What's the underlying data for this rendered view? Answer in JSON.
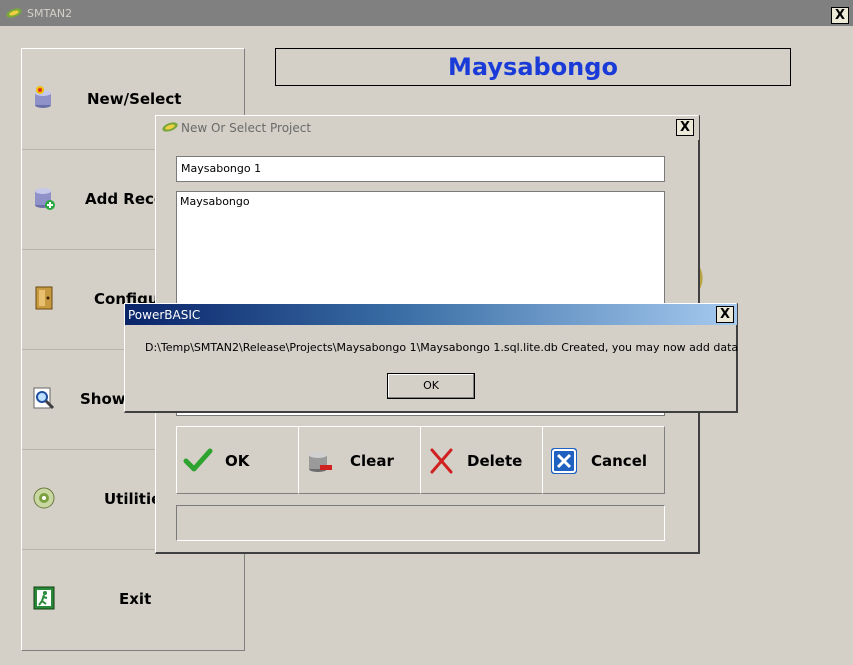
{
  "window": {
    "title": "SMTAN2",
    "close_label": "X"
  },
  "nav": {
    "items": [
      {
        "label": "New/Select",
        "icon": "new-database-icon"
      },
      {
        "label": "Add Records",
        "icon": "add-database-icon"
      },
      {
        "label": "Configure",
        "icon": "door-icon"
      },
      {
        "label": "Show",
        "icon": "magnifier-icon"
      },
      {
        "label": "Utilities",
        "icon": "cd-icon"
      },
      {
        "label": "Exit",
        "icon": "exit-icon"
      }
    ]
  },
  "project_banner": "Maysabongo",
  "background_fragment": ")",
  "dialog": {
    "title": "New Or Select Project",
    "close_label": "X",
    "project_name_value": "Maysabongo 1",
    "project_list": [
      "Maysabongo"
    ],
    "buttons": [
      {
        "label": "OK",
        "icon": "checkmark-icon"
      },
      {
        "label": "Clear",
        "icon": "clear-database-icon"
      },
      {
        "label": "Delete",
        "icon": "red-x-icon"
      },
      {
        "label": "Cancel",
        "icon": "cancel-icon"
      }
    ],
    "status_value": ""
  },
  "message_box": {
    "title": "PowerBASIC",
    "close_label": "X",
    "text": "D:\\Temp\\SMTAN2\\Release\\Projects\\Maysabongo 1\\Maysabongo 1.sql.lite.db Created, you may now add data",
    "ok_label": "OK"
  },
  "colors": {
    "accent": "#1a3bd8",
    "msg_title_start": "#0a246a",
    "msg_title_end": "#a6caf0"
  }
}
